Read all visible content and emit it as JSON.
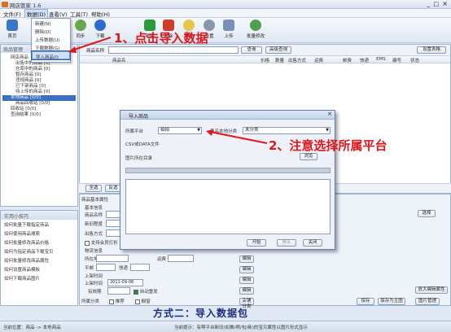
{
  "window": {
    "title": "网店管家 1.6"
  },
  "menu": {
    "items": [
      "文件(F)",
      "数据(D)",
      "查看(V)",
      "工具(T)",
      "帮助(H)"
    ]
  },
  "toolbar": {
    "home": "首页",
    "sync": "同步",
    "download": "下载",
    "new": "新建",
    "delete": "删除",
    "update": "更新",
    "settings": "设置",
    "upload": "上传",
    "batch_edit": "批量修改"
  },
  "dropdown": {
    "items": [
      "新建(N)",
      "删除(D)",
      "上传数据(U)",
      "下载数据(G)",
      "导入商品(I)"
    ]
  },
  "annotation1": "1、点击导入数据",
  "annotation2": "2、注意选择所属平台",
  "caption": "方式二：导入数据包",
  "sidebar": {
    "header": "商品管理",
    "tree": [
      "网店商品",
      "出售中的商品 [0]",
      "仓库中的商品 [0]",
      "暂存商品 [0]",
      "违规商品 [0]",
      "已下架商品 [0]",
      "待上传的商品 [0]",
      "本地商品 [0/0]",
      "商品回收站 [0/0]",
      "回收站 [0/0]",
      "查询结果 [0/0]"
    ]
  },
  "tips": {
    "header": "实用小技巧",
    "items": [
      "如何批量下载指定商品",
      "如何使用商品搜索",
      "如何批量修改商品价格",
      "如何为指定商品下载宝贝",
      "如何批量修改商品属性",
      "如何设置商品模板",
      "如何下载商品图片"
    ]
  },
  "main": {
    "search_label": "商品名称",
    "query_btn": "查询",
    "advanced_btn": "高级查询",
    "settings_btn": "设置表格",
    "columns": [
      "商品名",
      "价格",
      "数量",
      "出售方式",
      "运费",
      "邮费",
      "快递",
      "EMS",
      "编号",
      "状态"
    ],
    "select_all": "全选",
    "invert": "反选"
  },
  "detail": {
    "tab": "商品基本属性",
    "basic_info": "基本信息",
    "title_label": "商品名称",
    "new_old_label": "新旧程度",
    "sale_type_label": "出售方式",
    "support_label": "支持会员打折",
    "logistics": "物流信息",
    "location_label": "所在地",
    "freight_label": "运费",
    "post_label": "平邮",
    "express_label": "快递",
    "upload_time": "上架时间",
    "upload_time_label": "上架时间",
    "date_value": "2011-09-08",
    "validity_label": "有效期",
    "auto_repost": "自动重发",
    "upload_btn": "编辑",
    "category_label": "所属分类",
    "recommend_label": "推荐",
    "window_label": "橱窗",
    "shop_btn": "店铺分类",
    "big_edit": "放大编辑属性",
    "preview_btn": "保存",
    "save_btn": "保存为主图",
    "detail_btn": "图片管理",
    "select_btn": "选择"
  },
  "dialog": {
    "title": "导入商品",
    "platform_label": "所属平台",
    "platform_value": "拍拍",
    "category_label": "商品本地分类",
    "category_value": "未分类",
    "csv_label": "CSV或DATA文件",
    "image_label": "图片所在目录",
    "browse_btn": "浏览",
    "start_btn": "开始",
    "stop_btn": "停止",
    "close_btn": "关闭"
  },
  "status": {
    "location": "当前位置：商品 -> 本地商品",
    "tip": "当前提示：有啊平台新旧(如推/明/包/新)的宝贝属性以图片形式显示"
  }
}
